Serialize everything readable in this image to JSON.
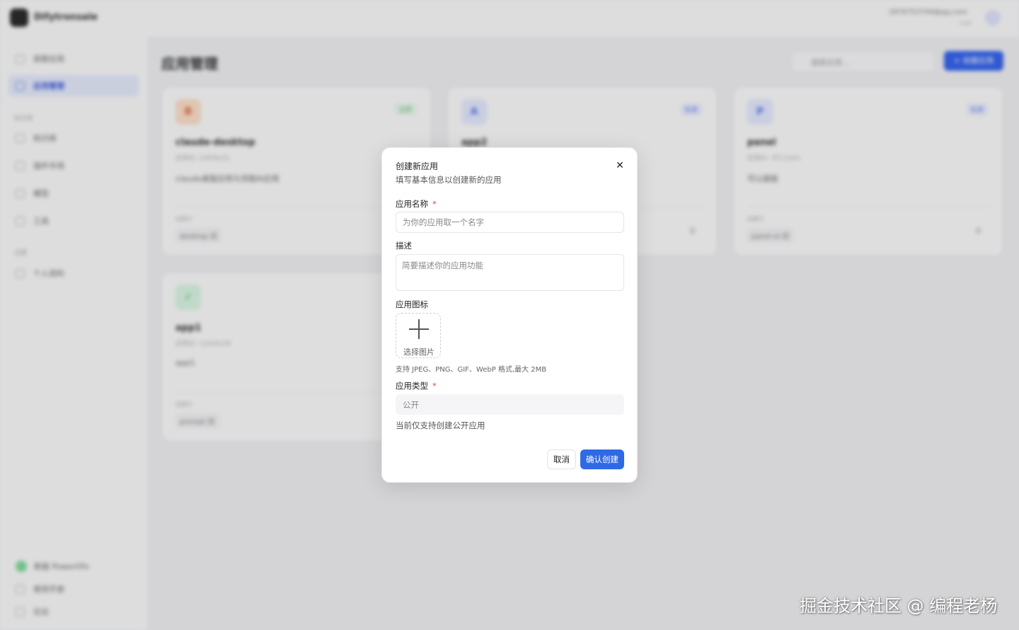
{
  "app": {
    "logo_text": "Difytronsale",
    "user_email": "2876753749@qq.com",
    "user_sub": "user",
    "avatar_letter": "D"
  },
  "sidebar": {
    "items": [
      {
        "label": "探索应用"
      },
      {
        "label": "应用管理"
      }
    ],
    "section_1": "知识库",
    "items_2": [
      {
        "label": "知识库"
      },
      {
        "label": "插件市场"
      },
      {
        "label": "模型"
      },
      {
        "label": "工具"
      }
    ],
    "section_2": "设置",
    "items_3": [
      {
        "label": "个人资料"
      }
    ],
    "bottom": [
      {
        "label": "新版 PowerOfx"
      },
      {
        "label": "使用手册"
      },
      {
        "label": "日志"
      }
    ]
  },
  "main": {
    "title": "应用管理",
    "search_placeholder": "搜索应用...",
    "new_button": "+ 创建应用",
    "cards": [
      {
        "icon": "B",
        "badge": "公开",
        "name": "claude-desktop",
        "id": "应用ID: 2df09a1b",
        "desc": "claude桌面应用与流程AI应用",
        "meta_label": "创建于",
        "meta_value": "desktop 应",
        "num": ""
      },
      {
        "icon": "A",
        "badge": "私有",
        "name": "app2",
        "id": "",
        "desc": "",
        "meta_label": "",
        "meta_value": "",
        "num": "0"
      },
      {
        "icon": "P",
        "badge": "私有",
        "name": "panel",
        "id": "应用ID: 3f7c2a01",
        "desc": "可以面板",
        "meta_label": "创建于",
        "meta_value": "panel-el 应",
        "num": "0"
      },
      {
        "icon": "✓",
        "badge": "",
        "name": "app1",
        "id": "应用ID: 1a5e9c08",
        "desc": "app1",
        "meta_label": "创建于",
        "meta_value": "prompt 应",
        "num": ""
      }
    ]
  },
  "modal": {
    "title": "创建新应用",
    "subtitle": "填写基本信息以创建新的应用",
    "name_label": "应用名称",
    "required_mark": "*",
    "name_placeholder": "为你的应用取一个名字",
    "desc_label": "描述",
    "desc_placeholder": "简要描述你的应用功能",
    "icon_label": "应用图标",
    "upload_text": "选择图片",
    "icon_hint": "支持 JPEG、PNG、GIF、WebP 格式,最大 2MB",
    "type_label": "应用类型",
    "type_value": "公开",
    "type_hint": "当前仅支持创建公开应用",
    "cancel": "取消",
    "confirm": "确认创建",
    "close_glyph": "✕"
  },
  "watermark": "掘金技术社区 @ 编程老杨",
  "colors": {
    "accent": "#2f6ae4",
    "required": "#e5484d"
  }
}
